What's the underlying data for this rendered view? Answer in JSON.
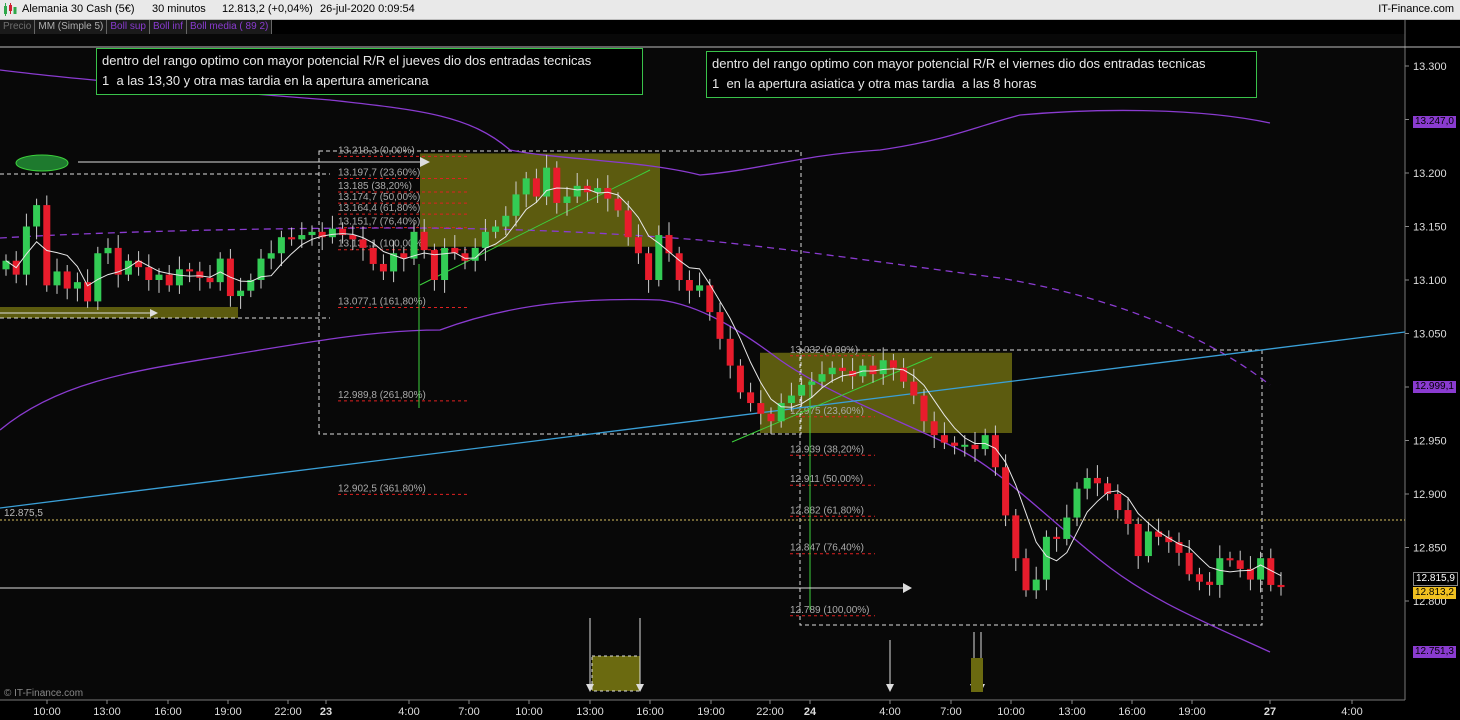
{
  "header": {
    "instrument": "Alemania 30 Cash (5€)",
    "timeframe": "30 minutos",
    "last": "12.813,2 (+0,04%)",
    "datetime": "26-jul-2020 0:09:54",
    "brand": "IT-Finance.com"
  },
  "legend": [
    {
      "label": "Precio",
      "color": "#6e6e6e"
    },
    {
      "label": "MM (Simple 5)",
      "color": "#b0b0b0"
    },
    {
      "label": "Boll sup",
      "color": "#8a3bd0"
    },
    {
      "label": "Boll inf",
      "color": "#8a3bd0"
    },
    {
      "label": "Boll media ( 89 2)",
      "color": "#8a3bd0"
    }
  ],
  "notes": {
    "thursday": "dentro del rango optimo con mayor potencial R/R el jueves dio dos entradas tecnicas\n1  a las 13,30 y otra mas tardia en la apertura americana",
    "friday": "dentro del rango optimo con mayor potencial R/R el viernes dio dos entradas tecnicas\n1  en la apertura asiatica y otra mas tardia  a las 8 horas"
  },
  "copyright": "© IT-Finance.com",
  "price_tags": {
    "last_a": "12.815,9",
    "last_b": "12.813,2",
    "boll_sup": "13.247,0",
    "boll_media": "12.999,1",
    "boll_inf": "12.751,3",
    "hline": "12.875,5"
  },
  "colors": {
    "up": "#33cc55",
    "down": "#e81c2c",
    "boll": "#8a3bd0",
    "trend": "#3aa0d8",
    "fib_box": "#6b6a10",
    "note_border": "#39c24a"
  },
  "chart_data": {
    "type": "candlestick",
    "y_ticks": [
      "13.300",
      "13.250",
      "13.200",
      "13.150",
      "13.100",
      "13.050",
      "13.000",
      "12.950",
      "12.900",
      "12.850",
      "12.800"
    ],
    "x_ticks": [
      "10:00",
      "13:00",
      "16:00",
      "19:00",
      "22:00",
      "23",
      "4:00",
      "7:00",
      "10:00",
      "13:00",
      "16:00",
      "19:00",
      "22:00",
      "24",
      "4:00",
      "7:00",
      "10:00",
      "13:00",
      "16:00",
      "19:00",
      "27",
      "4:00"
    ],
    "fib_thursday": [
      {
        "label": "13.218,3 (0,00%)",
        "price": 13218.3
      },
      {
        "label": "13.197,7 (23,60%)",
        "price": 13197.7
      },
      {
        "label": "13.185 (38,20%)",
        "price": 13185
      },
      {
        "label": "13.174,7 (50,00%)",
        "price": 13174.7
      },
      {
        "label": "13.164,4 (61,80%)",
        "price": 13164.4
      },
      {
        "label": "13.151,7 (76,40%)",
        "price": 13151.7
      },
      {
        "label": "13.131,1 (100,00%)",
        "price": 13131.1
      },
      {
        "label": "13.077,1 (161,80%)",
        "price": 13077.1
      },
      {
        "label": "12.989,8 (261,80%)",
        "price": 12989.8
      },
      {
        "label": "12.902,5 (361,80%)",
        "price": 12902.5
      }
    ],
    "fib_friday": [
      {
        "label": "13.032 (0,00%)",
        "price": 13032
      },
      {
        "label": "12.975 (23,60%)",
        "price": 12975
      },
      {
        "label": "12.939 (38,20%)",
        "price": 12939
      },
      {
        "label": "12.911 (50,00%)",
        "price": 12911
      },
      {
        "label": "12.882 (61,80%)",
        "price": 12882
      },
      {
        "label": "12.847 (76,40%)",
        "price": 12847
      },
      {
        "label": "12.789 (100,00%)",
        "price": 12789
      }
    ],
    "candles_close": [
      13118,
      13105,
      13150,
      13170,
      13095,
      13108,
      13092,
      13098,
      13080,
      13125,
      13130,
      13105,
      13118,
      13112,
      13100,
      13105,
      13095,
      13110,
      13108,
      13102,
      13098,
      13120,
      13085,
      13090,
      13100,
      13120,
      13125,
      13140,
      13138,
      13142,
      13145,
      13140,
      13148,
      13142,
      13138,
      13130,
      13115,
      13108,
      13125,
      13120,
      13145,
      13128,
      13100,
      13130,
      13125,
      13118,
      13130,
      13145,
      13150,
      13160,
      13180,
      13195,
      13178,
      13205,
      13172,
      13178,
      13188,
      13182,
      13186,
      13176,
      13165,
      13140,
      13125,
      13100,
      13142,
      13125,
      13100,
      13090,
      13095,
      13070,
      13045,
      13020,
      12995,
      12985,
      12975,
      12968,
      12985,
      12992,
      13002,
      13005,
      13012,
      13018,
      13015,
      13010,
      13020,
      13012,
      13025,
      13018,
      13005,
      12992,
      12968,
      12955,
      12948,
      12945,
      12946,
      12942,
      12955,
      12925,
      12880,
      12840,
      12810,
      12820,
      12860,
      12858,
      12878,
      12905,
      12915,
      12910,
      12900,
      12885,
      12872,
      12842,
      12865,
      12860,
      12855,
      12845,
      12825,
      12818,
      12815,
      12840,
      12838,
      12830,
      12820,
      12840,
      12815,
      12813
    ]
  }
}
